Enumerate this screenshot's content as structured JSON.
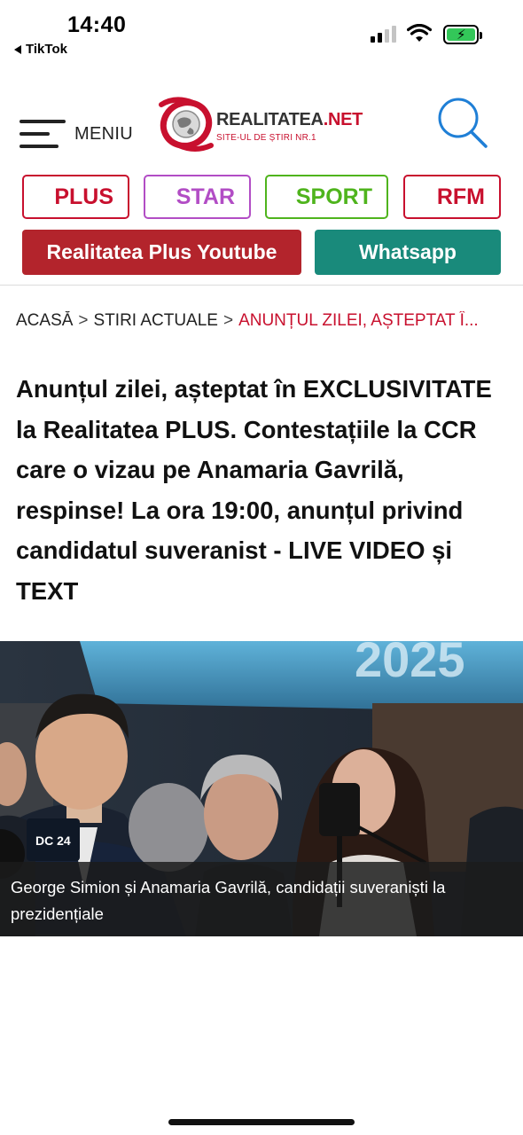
{
  "status_bar": {
    "time": "14:40",
    "back_app": "TikTok"
  },
  "header": {
    "menu_label": "MENIU",
    "logo_name_main": "REALITATEA",
    "logo_name_suffix": ".NET",
    "logo_tagline": "SITE-UL DE ȘTIRI NR.1"
  },
  "sections": {
    "plus": "PLUS",
    "star": "STAR",
    "sport": "SPORT",
    "rfm": "RFM"
  },
  "promo_buttons": {
    "youtube": "Realitatea Plus Youtube",
    "whatsapp": "Whatsapp"
  },
  "breadcrumb": {
    "home": "ACASĂ",
    "section": "STIRI ACTUALE",
    "current": "ANUNȚUL ZILEI, AȘTEPTAT Î..."
  },
  "article": {
    "title": "Anunțul zilei, așteptat în EXCLUSIVITATE la Realitatea PLUS. Contestațiile la CCR care o vizau pe Anamaria Gavrilă, respinse! La ora 19:00, anunțul privind candidatul suveranist - LIVE VIDEO și TEXT",
    "image_caption": "George Simion și Anamaria Gavrilă, candidații suveraniști la prezidențiale",
    "banner_text": "2025",
    "mic_label": "DC 24"
  },
  "colors": {
    "brand_red": "#c8102e",
    "star_purple": "#b24dc5",
    "sport_green": "#4fb41d",
    "youtube_red": "#b3242c",
    "whatsapp_teal": "#198a7b"
  }
}
